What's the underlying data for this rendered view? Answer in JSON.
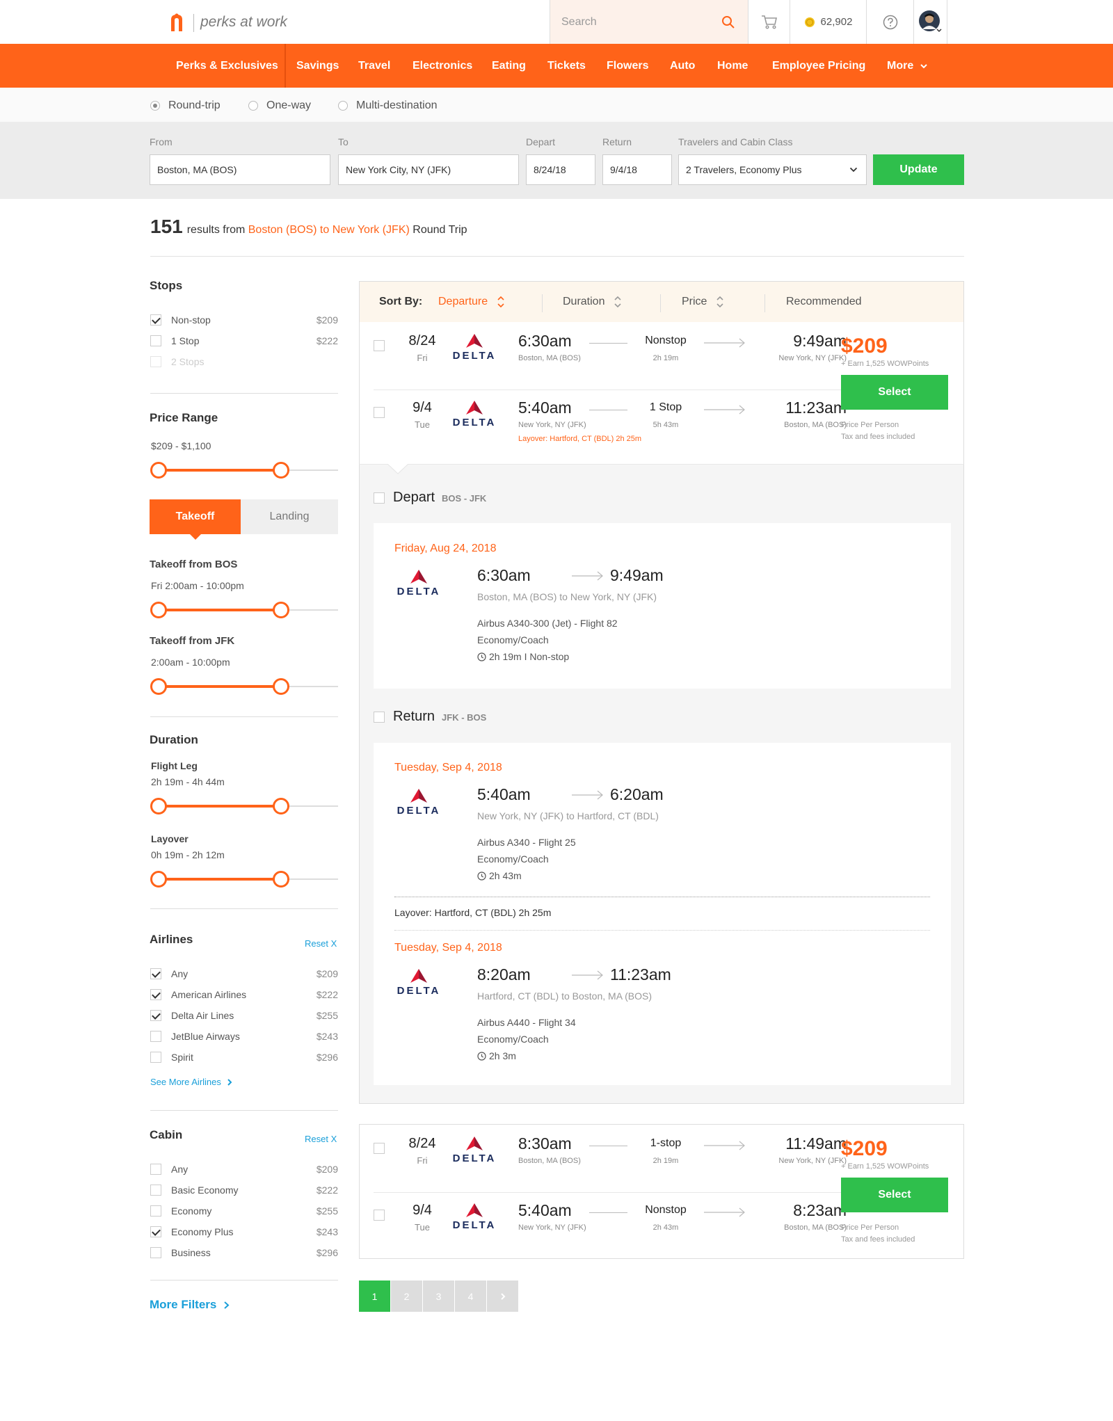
{
  "header": {
    "logo_text": "perks at work",
    "search_placeholder": "Search",
    "points": "62,902"
  },
  "nav": [
    "Perks & Exclusives",
    "Savings",
    "Travel",
    "Electronics",
    "Eating",
    "Tickets",
    "Flowers",
    "Auto",
    "Home",
    "Employee Pricing",
    "More"
  ],
  "trip_type": {
    "options": [
      "Round-trip",
      "One-way",
      "Multi-destination"
    ],
    "selected": "Round-trip"
  },
  "form": {
    "from_label": "From",
    "from_value": "Boston, MA (BOS)",
    "to_label": "To",
    "to_value": "New York City, NY (JFK)",
    "depart_label": "Depart",
    "depart_value": "8/24/18",
    "return_label": "Return",
    "return_value": "9/4/18",
    "travelers_label": "Travelers and Cabin Class",
    "travelers_value": "2 Travelers, Economy Plus",
    "update_label": "Update"
  },
  "results": {
    "count": "151",
    "mid": "results from",
    "route": "Boston (BOS) to New York (JFK)",
    "suffix": "Round Trip"
  },
  "sidebar": {
    "stops_title": "Stops",
    "stops": [
      {
        "label": "Non-stop",
        "price": "$209",
        "checked": true
      },
      {
        "label": "1 Stop",
        "price": "$222",
        "checked": false
      },
      {
        "label": "2 Stops",
        "price": "",
        "checked": false,
        "disabled": true
      }
    ],
    "price_title": "Price Range",
    "price_range": "$209  -  $1,100",
    "toggle_takeoff": "Takeoff",
    "toggle_landing": "Landing",
    "takeoff_bos": "Takeoff from BOS",
    "takeoff_bos_range": "Fri 2:00am  -  10:00pm",
    "takeoff_jfk": "Takeoff from  JFK",
    "takeoff_jfk_range": "2:00am  -  10:00pm",
    "duration_title": "Duration",
    "flight_leg": "Flight Leg",
    "flight_leg_range": "2h 19m  -  4h 44m",
    "layover": "Layover",
    "layover_range": "0h 19m  -  2h 12m",
    "airlines_title": "Airlines",
    "reset": "Reset X",
    "airlines": [
      {
        "label": "Any",
        "price": "$209",
        "checked": true
      },
      {
        "label": "American Airlines",
        "price": "$222",
        "checked": true
      },
      {
        "label": "Delta Air Lines",
        "price": "$255",
        "checked": true
      },
      {
        "label": "JetBlue Airways",
        "price": "$243",
        "checked": false
      },
      {
        "label": "Spirit",
        "price": "$296",
        "checked": false
      }
    ],
    "see_more": "See More Airlines",
    "cabin_title": "Cabin",
    "cabin": [
      {
        "label": "Any",
        "price": "$209",
        "checked": false
      },
      {
        "label": "Basic Economy",
        "price": "$222",
        "checked": false
      },
      {
        "label": "Economy",
        "price": "$255",
        "checked": false
      },
      {
        "label": "Economy Plus",
        "price": "$243",
        "checked": true
      },
      {
        "label": "Business",
        "price": "$296",
        "checked": false
      }
    ],
    "more_filters": "More Filters"
  },
  "sort": {
    "label": "Sort By:",
    "options": [
      "Departure",
      "Duration",
      "Price",
      "Recommended"
    ],
    "active": "Departure"
  },
  "airline_name": "DELTA",
  "flights": [
    {
      "price": "$209",
      "earn": "+ Earn 1,525 WOWPoints",
      "select": "Select",
      "ppp": "Price Per Person",
      "tax": "Tax and fees included",
      "legs": [
        {
          "date": "8/24",
          "dow": "Fri",
          "dep": "6:30am",
          "dep_city": "Boston, MA (BOS)",
          "stops": "Nonstop",
          "dur": "2h 19m",
          "arr": "9:49am",
          "arr_city": "New York, NY (JFK)",
          "layover": ""
        },
        {
          "date": "9/4",
          "dow": "Tue",
          "dep": "5:40am",
          "dep_city": "New York, NY (JFK)",
          "stops": "1 Stop",
          "dur": "5h 43m",
          "arr": "11:23am",
          "arr_city": "Boston, MA (BOS)",
          "layover": "Layover: Hartford, CT (BDL)  2h 25m"
        }
      ]
    },
    {
      "price": "$209",
      "earn": "+ Earn 1,525 WOWPoints",
      "select": "Select",
      "ppp": "Price Per Person",
      "tax": "Tax and fees included",
      "legs": [
        {
          "date": "8/24",
          "dow": "Fri",
          "dep": "8:30am",
          "dep_city": "Boston, MA (BOS)",
          "stops": "1-stop",
          "dur": "2h 19m",
          "arr": "11:49am",
          "arr_city": "New York, NY (JFK)",
          "layover": ""
        },
        {
          "date": "9/4",
          "dow": "Tue",
          "dep": "5:40am",
          "dep_city": "New York, NY (JFK)",
          "stops": "Nonstop",
          "dur": "2h 43m",
          "arr": "8:23am",
          "arr_city": "Boston, MA (BOS)",
          "layover": ""
        }
      ]
    }
  ],
  "details": {
    "depart_title": "Depart",
    "depart_code": "BOS - JFK",
    "return_title": "Return",
    "return_code": "JFK - BOS",
    "depart_seg": {
      "date": "Friday, Aug 24, 2018",
      "dep": "6:30am",
      "arr": "9:49am",
      "route": "Boston, MA (BOS) to New York, NY (JFK)",
      "aircraft": "Airbus A340-300 (Jet) - Flight 82",
      "cabin": "Economy/Coach",
      "duration": "2h 19m  I  Non-stop"
    },
    "return_seg1": {
      "date": "Tuesday, Sep 4, 2018",
      "dep": "5:40am",
      "arr": "6:20am",
      "route": "New York, NY (JFK) to Hartford, CT (BDL)",
      "aircraft": "Airbus A340 - Flight 25",
      "cabin": "Economy/Coach",
      "duration": "2h 43m"
    },
    "layover": "Layover: Hartford, CT (BDL)  2h 25m",
    "return_seg2": {
      "date": "Tuesday, Sep 4, 2018",
      "dep": "8:20am",
      "arr": "11:23am",
      "route": "Hartford, CT (BDL) to Boston, MA (BOS)",
      "aircraft": "Airbus A440 - Flight 34",
      "cabin": "Economy/Coach",
      "duration": "2h 3m"
    }
  },
  "pagination": [
    "1",
    "2",
    "3",
    "4"
  ],
  "colors": {
    "brand": "#ff6319",
    "green": "#2fbf4c",
    "link": "#1a9fd9"
  }
}
